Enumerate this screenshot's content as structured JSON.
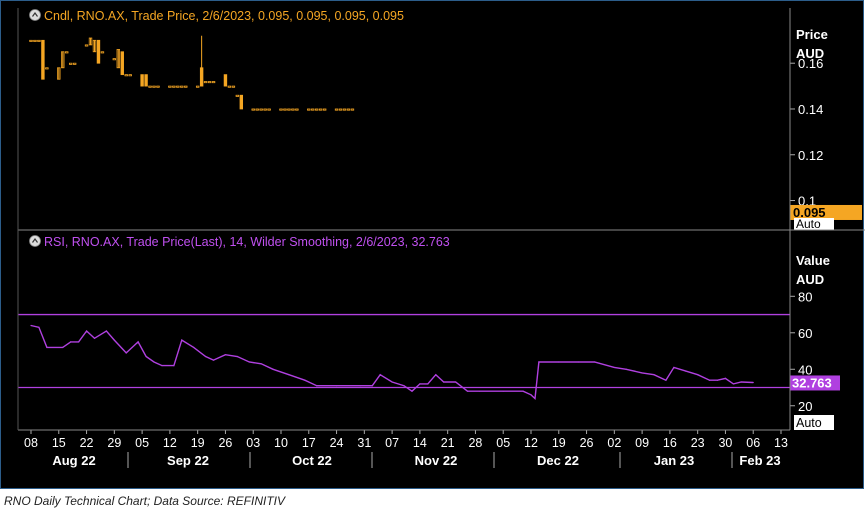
{
  "caption": "RNO Daily Technical Chart; Data Source: REFINITIV",
  "colors": {
    "background": "#000000",
    "candle": "#f5a623",
    "rsi": "#b040e0",
    "grid": "#333333",
    "axis_text": "#ffffff",
    "price_badge_bg": "#f5a623",
    "price_badge_text": "#000000",
    "rsi_badge_bg": "#b040e0",
    "rsi_badge_text": "#ffffff"
  },
  "chart_data": [
    {
      "type": "candlestick",
      "legend": "Cndl, RNO.AX, Trade Price, 2/6/2023, 0.095, 0.095, 0.095, 0.095",
      "axis_title_line1": "Price",
      "axis_title_line2": "AUD",
      "ylim": [
        0.088,
        0.178
      ],
      "yticks": [
        0.16,
        0.14,
        0.12,
        0.1
      ],
      "ytick_labels": [
        "0.16",
        "0.14",
        "0.12",
        "0.1"
      ],
      "last_value": "0.095",
      "corner_label": "Auto",
      "candles": [
        {
          "d": "2022-08-08",
          "o": 0.17,
          "h": 0.17,
          "l": 0.17,
          "c": 0.17
        },
        {
          "d": "2022-08-09",
          "o": 0.17,
          "h": 0.17,
          "l": 0.17,
          "c": 0.17
        },
        {
          "d": "2022-08-10",
          "o": 0.17,
          "h": 0.17,
          "l": 0.17,
          "c": 0.17
        },
        {
          "d": "2022-08-11",
          "o": 0.17,
          "h": 0.17,
          "l": 0.153,
          "c": 0.153
        },
        {
          "d": "2022-08-12",
          "o": 0.158,
          "h": 0.158,
          "l": 0.158,
          "c": 0.158
        },
        {
          "d": "2022-08-15",
          "o": 0.153,
          "h": 0.158,
          "l": 0.153,
          "c": 0.158
        },
        {
          "d": "2022-08-16",
          "o": 0.158,
          "h": 0.165,
          "l": 0.158,
          "c": 0.165
        },
        {
          "d": "2022-08-17",
          "o": 0.165,
          "h": 0.165,
          "l": 0.165,
          "c": 0.165
        },
        {
          "d": "2022-08-18",
          "o": 0.16,
          "h": 0.16,
          "l": 0.16,
          "c": 0.16
        },
        {
          "d": "2022-08-19",
          "o": 0.16,
          "h": 0.16,
          "l": 0.16,
          "c": 0.16
        },
        {
          "d": "2022-08-22",
          "o": 0.168,
          "h": 0.168,
          "l": 0.168,
          "c": 0.168
        },
        {
          "d": "2022-08-23",
          "o": 0.168,
          "h": 0.171,
          "l": 0.168,
          "c": 0.171
        },
        {
          "d": "2022-08-24",
          "o": 0.165,
          "h": 0.17,
          "l": 0.165,
          "c": 0.17
        },
        {
          "d": "2022-08-25",
          "o": 0.17,
          "h": 0.17,
          "l": 0.16,
          "c": 0.16
        },
        {
          "d": "2022-08-26",
          "o": 0.165,
          "h": 0.165,
          "l": 0.165,
          "c": 0.165
        },
        {
          "d": "2022-08-29",
          "o": 0.162,
          "h": 0.162,
          "l": 0.162,
          "c": 0.162
        },
        {
          "d": "2022-08-30",
          "o": 0.158,
          "h": 0.166,
          "l": 0.158,
          "c": 0.166
        },
        {
          "d": "2022-08-31",
          "o": 0.165,
          "h": 0.165,
          "l": 0.155,
          "c": 0.155
        },
        {
          "d": "2022-09-01",
          "o": 0.155,
          "h": 0.155,
          "l": 0.155,
          "c": 0.155
        },
        {
          "d": "2022-09-02",
          "o": 0.155,
          "h": 0.155,
          "l": 0.155,
          "c": 0.155
        },
        {
          "d": "2022-09-05",
          "o": 0.155,
          "h": 0.155,
          "l": 0.15,
          "c": 0.15
        },
        {
          "d": "2022-09-06",
          "o": 0.155,
          "h": 0.155,
          "l": 0.15,
          "c": 0.15
        },
        {
          "d": "2022-09-07",
          "o": 0.15,
          "h": 0.15,
          "l": 0.15,
          "c": 0.15
        },
        {
          "d": "2022-09-08",
          "o": 0.15,
          "h": 0.15,
          "l": 0.15,
          "c": 0.15
        },
        {
          "d": "2022-09-09",
          "o": 0.15,
          "h": 0.15,
          "l": 0.15,
          "c": 0.15
        },
        {
          "d": "2022-09-12",
          "o": 0.15,
          "h": 0.15,
          "l": 0.15,
          "c": 0.15
        },
        {
          "d": "2022-09-13",
          "o": 0.15,
          "h": 0.15,
          "l": 0.15,
          "c": 0.15
        },
        {
          "d": "2022-09-14",
          "o": 0.15,
          "h": 0.15,
          "l": 0.15,
          "c": 0.15
        },
        {
          "d": "2022-09-15",
          "o": 0.15,
          "h": 0.15,
          "l": 0.15,
          "c": 0.15
        },
        {
          "d": "2022-09-16",
          "o": 0.15,
          "h": 0.15,
          "l": 0.15,
          "c": 0.15
        },
        {
          "d": "2022-09-19",
          "o": 0.15,
          "h": 0.15,
          "l": 0.15,
          "c": 0.15
        },
        {
          "d": "2022-09-20",
          "o": 0.158,
          "h": 0.172,
          "l": 0.15,
          "c": 0.15
        },
        {
          "d": "2022-09-21",
          "o": 0.152,
          "h": 0.152,
          "l": 0.152,
          "c": 0.152
        },
        {
          "d": "2022-09-22",
          "o": 0.152,
          "h": 0.152,
          "l": 0.152,
          "c": 0.152
        },
        {
          "d": "2022-09-23",
          "o": 0.152,
          "h": 0.152,
          "l": 0.152,
          "c": 0.152
        },
        {
          "d": "2022-09-26",
          "o": 0.155,
          "h": 0.155,
          "l": 0.15,
          "c": 0.15
        },
        {
          "d": "2022-09-27",
          "o": 0.15,
          "h": 0.15,
          "l": 0.15,
          "c": 0.15
        },
        {
          "d": "2022-09-28",
          "o": 0.15,
          "h": 0.15,
          "l": 0.15,
          "c": 0.15
        },
        {
          "d": "2022-09-29",
          "o": 0.146,
          "h": 0.146,
          "l": 0.146,
          "c": 0.146
        },
        {
          "d": "2022-09-30",
          "o": 0.146,
          "h": 0.146,
          "l": 0.14,
          "c": 0.14
        },
        {
          "d": "2022-10-03",
          "o": 0.14,
          "h": 0.14,
          "l": 0.14,
          "c": 0.14
        },
        {
          "d": "2022-10-04",
          "o": 0.14,
          "h": 0.14,
          "l": 0.14,
          "c": 0.14
        },
        {
          "d": "2022-10-05",
          "o": 0.14,
          "h": 0.14,
          "l": 0.14,
          "c": 0.14
        },
        {
          "d": "2022-10-06",
          "o": 0.14,
          "h": 0.14,
          "l": 0.14,
          "c": 0.14
        },
        {
          "d": "2022-10-07",
          "o": 0.14,
          "h": 0.14,
          "l": 0.14,
          "c": 0.14
        },
        {
          "d": "2022-10-10",
          "o": 0.14,
          "h": 0.14,
          "l": 0.14,
          "c": 0.14
        },
        {
          "d": "2022-10-11",
          "o": 0.14,
          "h": 0.14,
          "l": 0.14,
          "c": 0.14
        },
        {
          "d": "2022-10-12",
          "o": 0.14,
          "h": 0.14,
          "l": 0.14,
          "c": 0.14
        },
        {
          "d": "2022-10-13",
          "o": 0.14,
          "h": 0.14,
          "l": 0.14,
          "c": 0.14
        },
        {
          "d": "2022-10-14",
          "o": 0.14,
          "h": 0.14,
          "l": 0.14,
          "c": 0.14
        },
        {
          "d": "2022-10-17",
          "o": 0.14,
          "h": 0.14,
          "l": 0.14,
          "c": 0.14
        },
        {
          "d": "2022-10-18",
          "o": 0.14,
          "h": 0.14,
          "l": 0.14,
          "c": 0.14
        },
        {
          "d": "2022-10-19",
          "o": 0.14,
          "h": 0.14,
          "l": 0.14,
          "c": 0.14
        },
        {
          "d": "2022-10-20",
          "o": 0.14,
          "h": 0.14,
          "l": 0.14,
          "c": 0.14
        },
        {
          "d": "2022-10-21",
          "o": 0.14,
          "h": 0.14,
          "l": 0.14,
          "c": 0.14
        },
        {
          "d": "2022-10-24",
          "o": 0.14,
          "h": 0.14,
          "l": 0.14,
          "c": 0.14
        },
        {
          "d": "2022-10-25",
          "o": 0.14,
          "h": 0.14,
          "l": 0.14,
          "c": 0.14
        },
        {
          "d": "2022-10-26",
          "o": 0.14,
          "h": 0.14,
          "l": 0.14,
          "c": 0.14
        },
        {
          "d": "2022-10-27",
          "o": 0.14,
          "h": 0.14,
          "l": 0.14,
          "c": 0.14
        },
        {
          "d": "2022-10-28",
          "o": 0.14,
          "h": 0.14,
          "l": 0.14,
          "c": 0.14
        }
      ]
    },
    {
      "type": "line",
      "legend": "RSI, RNO.AX, Trade Price(Last),  14, Wilder Smoothing, 2/6/2023, 32.763",
      "axis_title_line1": "Value",
      "axis_title_line2": "AUD",
      "ylim": [
        10,
        84
      ],
      "yticks": [
        80,
        60,
        40,
        20
      ],
      "ytick_labels": [
        "80",
        "60",
        "40",
        "20"
      ],
      "upper_band": 70,
      "lower_band": 30,
      "last_value": "32.763",
      "corner_label": "Auto",
      "series": [
        {
          "d": "2022-08-08",
          "v": 64
        },
        {
          "d": "2022-08-10",
          "v": 63
        },
        {
          "d": "2022-08-12",
          "v": 52
        },
        {
          "d": "2022-08-16",
          "v": 52
        },
        {
          "d": "2022-08-18",
          "v": 55
        },
        {
          "d": "2022-08-20",
          "v": 55
        },
        {
          "d": "2022-08-22",
          "v": 61
        },
        {
          "d": "2022-08-24",
          "v": 57
        },
        {
          "d": "2022-08-27",
          "v": 61
        },
        {
          "d": "2022-08-29",
          "v": 56
        },
        {
          "d": "2022-09-01",
          "v": 49
        },
        {
          "d": "2022-09-04",
          "v": 55
        },
        {
          "d": "2022-09-06",
          "v": 47
        },
        {
          "d": "2022-09-08",
          "v": 44
        },
        {
          "d": "2022-09-10",
          "v": 42
        },
        {
          "d": "2022-09-13",
          "v": 42
        },
        {
          "d": "2022-09-15",
          "v": 56
        },
        {
          "d": "2022-09-18",
          "v": 52
        },
        {
          "d": "2022-09-21",
          "v": 47
        },
        {
          "d": "2022-09-23",
          "v": 45
        },
        {
          "d": "2022-09-26",
          "v": 48
        },
        {
          "d": "2022-09-29",
          "v": 47
        },
        {
          "d": "2022-10-02",
          "v": 44
        },
        {
          "d": "2022-10-05",
          "v": 43
        },
        {
          "d": "2022-10-08",
          "v": 40
        },
        {
          "d": "2022-10-12",
          "v": 37
        },
        {
          "d": "2022-10-16",
          "v": 34
        },
        {
          "d": "2022-10-19",
          "v": 31
        },
        {
          "d": "2022-10-24",
          "v": 31
        },
        {
          "d": "2022-10-30",
          "v": 31
        },
        {
          "d": "2022-11-02",
          "v": 31
        },
        {
          "d": "2022-11-04",
          "v": 37
        },
        {
          "d": "2022-11-07",
          "v": 33
        },
        {
          "d": "2022-11-10",
          "v": 31
        },
        {
          "d": "2022-11-12",
          "v": 28
        },
        {
          "d": "2022-11-14",
          "v": 32
        },
        {
          "d": "2022-11-16",
          "v": 32
        },
        {
          "d": "2022-11-18",
          "v": 37
        },
        {
          "d": "2022-11-20",
          "v": 33
        },
        {
          "d": "2022-11-23",
          "v": 33
        },
        {
          "d": "2022-11-26",
          "v": 28
        },
        {
          "d": "2022-11-29",
          "v": 28
        },
        {
          "d": "2022-12-05",
          "v": 28
        },
        {
          "d": "2022-12-10",
          "v": 28
        },
        {
          "d": "2022-12-12",
          "v": 26
        },
        {
          "d": "2022-12-13",
          "v": 24
        },
        {
          "d": "2022-12-14",
          "v": 44
        },
        {
          "d": "2022-12-19",
          "v": 44
        },
        {
          "d": "2022-12-24",
          "v": 44
        },
        {
          "d": "2022-12-28",
          "v": 44
        },
        {
          "d": "2023-01-02",
          "v": 41
        },
        {
          "d": "2023-01-05",
          "v": 40
        },
        {
          "d": "2023-01-09",
          "v": 38
        },
        {
          "d": "2023-01-12",
          "v": 37
        },
        {
          "d": "2023-01-15",
          "v": 34
        },
        {
          "d": "2023-01-17",
          "v": 41
        },
        {
          "d": "2023-01-20",
          "v": 39
        },
        {
          "d": "2023-01-23",
          "v": 37
        },
        {
          "d": "2023-01-26",
          "v": 34
        },
        {
          "d": "2023-01-28",
          "v": 34
        },
        {
          "d": "2023-01-30",
          "v": 35
        },
        {
          "d": "2023-02-01",
          "v": 32
        },
        {
          "d": "2023-02-03",
          "v": 33
        },
        {
          "d": "2023-02-06",
          "v": 32.763
        }
      ]
    }
  ],
  "xaxis": {
    "day_ticks": [
      "08",
      "15",
      "22",
      "29",
      "05",
      "12",
      "19",
      "26",
      "03",
      "10",
      "17",
      "24",
      "31",
      "07",
      "14",
      "21",
      "28",
      "05",
      "12",
      "19",
      "26",
      "02",
      "09",
      "16",
      "23",
      "30",
      "06",
      "13"
    ],
    "months": [
      "Aug 22",
      "Sep 22",
      "Oct 22",
      "Nov 22",
      "Dec 22",
      "Jan 23",
      "Feb 23"
    ]
  }
}
